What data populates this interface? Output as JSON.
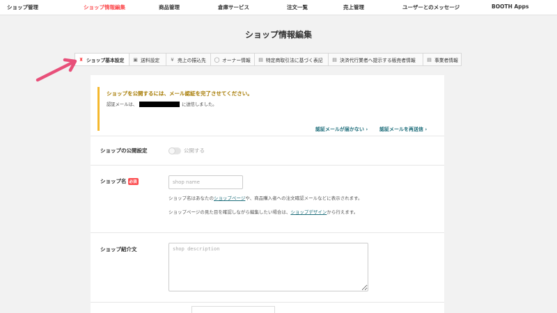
{
  "topnav": {
    "items": [
      {
        "label": "ショップ管理",
        "active": false
      },
      {
        "label": "ショップ情報編集",
        "active": true
      },
      {
        "label": "商品管理",
        "active": false
      },
      {
        "label": "倉庫サービス",
        "active": false
      },
      {
        "label": "注文一覧",
        "active": false
      },
      {
        "label": "売上管理",
        "active": false
      },
      {
        "label": "ユーザーとのメッセージ",
        "active": false
      },
      {
        "label": "BOOTH Apps",
        "active": false
      }
    ]
  },
  "page": {
    "title": "ショップ情報編集"
  },
  "tabs": [
    {
      "label": "ショップ基本設定",
      "icon": "shop-icon",
      "active": true
    },
    {
      "label": "送料設定",
      "icon": "truck-icon",
      "active": false
    },
    {
      "label": "売上の振込先",
      "icon": "yen-icon",
      "active": false
    },
    {
      "label": "オーナー情報",
      "icon": "person-icon",
      "active": false
    },
    {
      "label": "特定商取引法に基づく表記",
      "icon": "document-icon",
      "active": false
    },
    {
      "label": "決済代行業者へ提示する販売者情報",
      "icon": "document-icon",
      "active": false
    },
    {
      "label": "事業者情報",
      "icon": "document-icon",
      "active": false
    }
  ],
  "notice": {
    "title": "ショップを公開するには、メール認証を完了させてください。",
    "text_before": "認証メールは、",
    "text_after": "に送信しました。",
    "link_not_received": "認証メールが届かない ›",
    "link_resend": "認証メールを再送信 ›"
  },
  "form": {
    "publish": {
      "label": "ショップの公開設定",
      "toggle_label": "公開する",
      "enabled": false
    },
    "shop_name": {
      "label": "ショップ名",
      "required_badge": "必須",
      "placeholder": "shop name",
      "value": "",
      "help1_pre": "ショップ名はあなたの",
      "help1_link": "ショップページ",
      "help1_post": "や、商品購入者への注文確認メールなどに表示されます。",
      "help2_pre": "ショップページの見た目を確認しながら編集したい場合は、",
      "help2_link": "ショップデザイン",
      "help2_post": "から行えます。"
    },
    "description": {
      "label": "ショップ紹介文",
      "placeholder": "shop description",
      "value": ""
    }
  },
  "colors": {
    "accent": "#fc4d50",
    "link": "#1d6d7a",
    "notice_border": "#f5b82e",
    "arrow": "#e8507a"
  }
}
